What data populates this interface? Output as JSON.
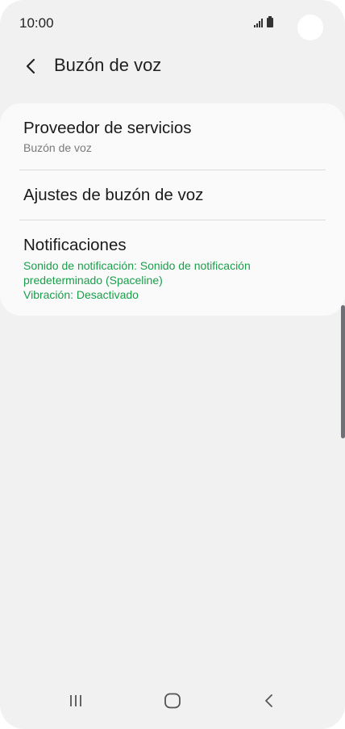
{
  "status_bar": {
    "time": "10:00",
    "signal_icon": "signal-bars-icon",
    "battery_icon": "battery-icon"
  },
  "header": {
    "back_icon": "chevron-left-icon",
    "title": "Buzón de voz"
  },
  "settings": {
    "items": [
      {
        "title": "Proveedor de servicios",
        "subtitle": "Buzón de voz"
      },
      {
        "title": "Ajustes de buzón de voz"
      },
      {
        "title": "Notificaciones",
        "detail_line1": "Sonido de notificación: Sonido de notificación",
        "detail_line2": "predeterminado (Spaceline)",
        "detail_line3": "Vibración: Desactivado"
      }
    ]
  },
  "navigation": {
    "recents_icon": "recent-apps-icon",
    "home_icon": "home-icon",
    "back_icon": "back-icon"
  },
  "colors": {
    "background": "#f1f1f1",
    "card": "#fafafa",
    "accent_green": "#1a9e4b"
  }
}
